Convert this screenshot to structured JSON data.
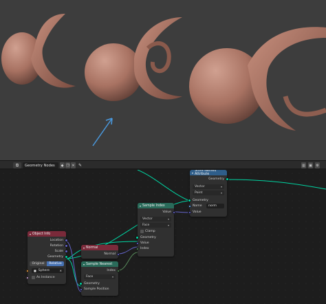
{
  "editor": {
    "tree_name": "Geometry Nodes",
    "icons": [
      "node-editor-icon",
      "shield-icon",
      "duplicate-icon",
      "close-icon",
      "pin-icon"
    ]
  },
  "nodes": {
    "object_info": {
      "title": "Object Info",
      "outputs": [
        "Location",
        "Rotation",
        "Scale",
        "Geometry"
      ],
      "mode_original": "Original",
      "mode_relative": "Relative",
      "object_value": "Sphere",
      "as_instance_label": "As Instance"
    },
    "normal": {
      "title": "Normal",
      "output": "Normal"
    },
    "sample_nearest": {
      "title": "Sample Nearest",
      "output": "Index",
      "domain": "Face",
      "inputs": [
        "Geometry",
        "Sample Position"
      ]
    },
    "sample_index": {
      "title": "Sample Index",
      "output": "Value",
      "data_type": "Vector",
      "domain": "Face",
      "clamp_label": "Clamp",
      "inputs": [
        "Geometry",
        "Value",
        "Index"
      ]
    },
    "store_named_attribute": {
      "title": "Store Named Attribute",
      "output": "Geometry",
      "data_type": "Vector",
      "domain": "Point",
      "inputs": [
        "Geometry",
        "Name",
        "Value"
      ],
      "name_value": "norm"
    }
  },
  "colors": {
    "geometry_socket": "#00d6a3",
    "vector_socket": "#6363c7",
    "integer_socket": "#598c5c",
    "string_socket": "#70b2ff",
    "input_header": "#7a2a3a",
    "geometry_header": "#2a6b5a",
    "attribute_header": "#2f5e8a",
    "arrow": "#4a9ae0"
  }
}
